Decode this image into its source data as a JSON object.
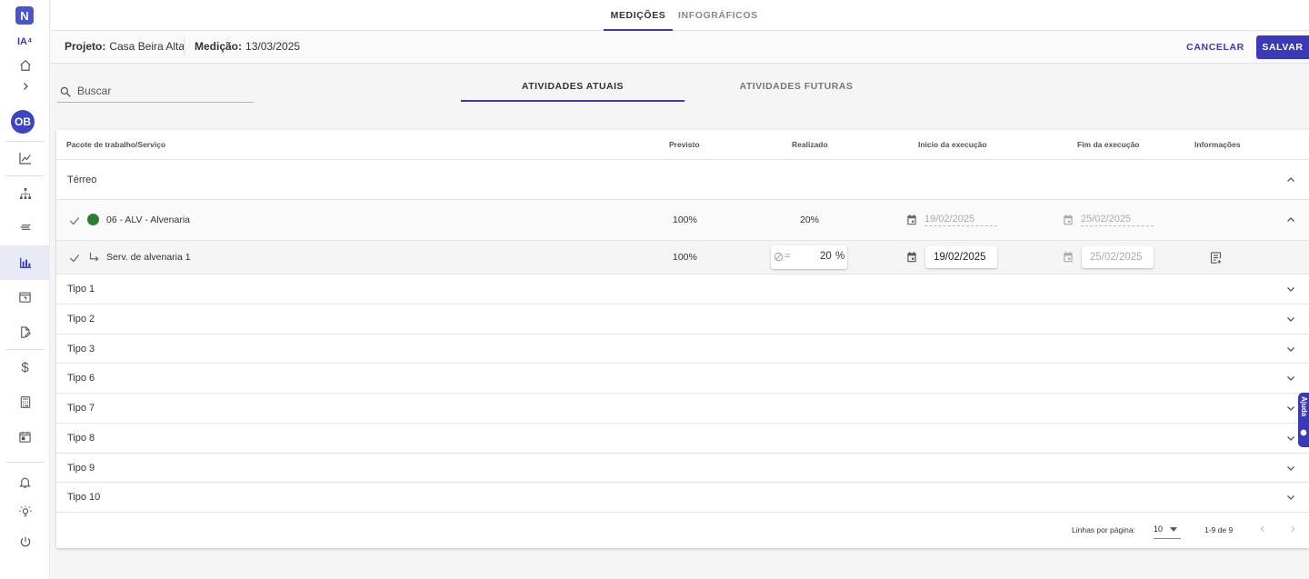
{
  "sidebar": {
    "logo_letter": "N",
    "ia_label": "IA⁴",
    "avatar_initials": "OB",
    "items": [
      {
        "name": "home-icon"
      },
      {
        "name": "chevron-right-icon"
      },
      {
        "name": "line-chart-icon"
      },
      {
        "name": "org-chart-icon"
      },
      {
        "name": "list-icon"
      },
      {
        "name": "bar-chart-icon",
        "active": true
      },
      {
        "name": "calendar-icon"
      },
      {
        "name": "document-edit-icon"
      },
      {
        "name": "dollar-icon"
      },
      {
        "name": "calculator-icon"
      },
      {
        "name": "schedule-icon"
      },
      {
        "name": "bell-icon"
      },
      {
        "name": "lightbulb-icon"
      },
      {
        "name": "power-icon"
      }
    ]
  },
  "top_tabs": [
    {
      "label": "MEDIÇÕES",
      "active": true
    },
    {
      "label": "INFOGRÁFICOS",
      "active": false
    }
  ],
  "infobar": {
    "project_label": "Projeto:",
    "project_value": "Casa Beira Alta",
    "measurement_label": "Medição:",
    "measurement_value": "13/03/2025",
    "cancel_label": "CANCELAR",
    "save_label": "SALVAR"
  },
  "search": {
    "placeholder": "Buscar"
  },
  "sub_tabs": [
    {
      "label": "ATIVIDADES ATUAIS",
      "active": true
    },
    {
      "label": "ATIVIDADES FUTURAS",
      "active": false
    }
  ],
  "table": {
    "headers": {
      "service": "Pacote de trabalho/Serviço",
      "planned": "Previsto",
      "done": "Realizado",
      "start": "Início da execução",
      "end": "Fim da execução",
      "info": "Informações"
    },
    "group_terreo": "Térreo",
    "package": {
      "name": "06 - ALV - Alvenaria",
      "planned": "100%",
      "done": "20%",
      "start": "19/02/2025",
      "end": "25/02/2025"
    },
    "service": {
      "name": "Serv. de alvenaria 1",
      "planned": "100%",
      "op_symbol": "=",
      "done_value": "20",
      "done_unit": "%",
      "start": "19/02/2025",
      "end": "25/02/2025"
    },
    "groups": [
      "Tipo 1",
      "Tipo 2",
      "Tipo 3",
      "Tipo 6",
      "Tipo 7",
      "Tipo 8",
      "Tipo 9",
      "Tipo 10"
    ]
  },
  "pagination": {
    "rows_per_page_label": "Linhas por página:",
    "rows_per_page_value": "10",
    "range_text": "1-9 de 9"
  },
  "help_tab_label": "Ajuda",
  "colors": {
    "accent": "#3a3ab8",
    "status_green": "#2e7d32"
  }
}
